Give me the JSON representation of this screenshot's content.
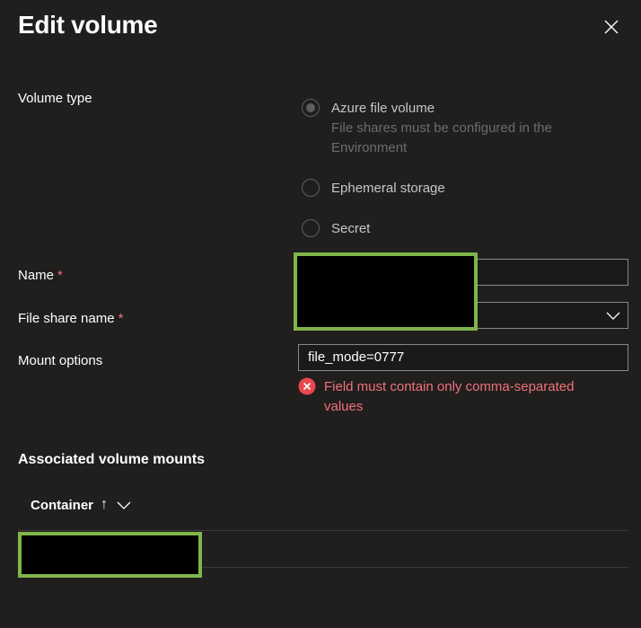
{
  "dialog": {
    "title": "Edit volume",
    "close_icon": "close-icon"
  },
  "volume_type": {
    "label": "Volume type",
    "options": [
      {
        "label": "Azure file volume",
        "description": "File shares must be configured in the Environment",
        "selected": true
      },
      {
        "label": "Ephemeral storage",
        "selected": false
      },
      {
        "label": "Secret",
        "selected": false
      }
    ]
  },
  "name": {
    "label": "Name",
    "required_mark": "*",
    "value": ""
  },
  "file_share_name": {
    "label": "File share name",
    "required_mark": "*",
    "value": "",
    "icon": "chevron-down-icon"
  },
  "mount_options": {
    "label": "Mount options",
    "value": "file_mode=0777",
    "error": "Field must contain only comma-separated values",
    "error_icon": "error-circle-icon"
  },
  "associated_mounts": {
    "title": "Associated volume mounts",
    "column_header": "Container",
    "sort_indicator": "↑",
    "header_icon": "chevron-down-icon"
  },
  "colors": {
    "background": "#201f1e",
    "error": "#f1707b",
    "redaction_border": "#7fb54a"
  }
}
